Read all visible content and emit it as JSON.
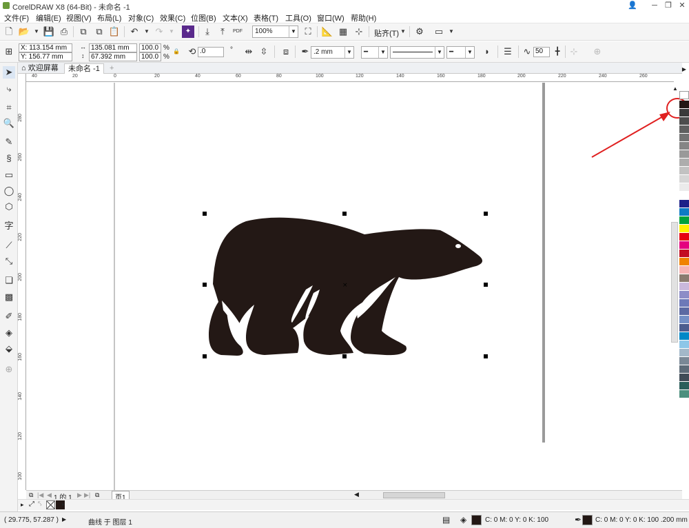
{
  "window": {
    "title": "CorelDRAW X8 (64-Bit) - 未命名 -1"
  },
  "menu": [
    "文件(F)",
    "编辑(E)",
    "视图(V)",
    "布局(L)",
    "对象(C)",
    "效果(C)",
    "位图(B)",
    "文本(X)",
    "表格(T)",
    "工具(O)",
    "窗口(W)",
    "帮助(H)"
  ],
  "toolbar": {
    "zoom": "100%",
    "snap_label": "贴齐(T)"
  },
  "properties": {
    "x": "X: 113.154 mm",
    "y": "Y: 156.77 mm",
    "width": "135.081 mm",
    "height": "67.392 mm",
    "scale_x": "100.0",
    "scale_y": "100.0",
    "percent": "%",
    "rotation": ".0",
    "degree": "°",
    "outline_width": ".2 mm",
    "smoothing": "50"
  },
  "tabs": {
    "welcome": "欢迎屏幕",
    "document": "未命名 -1"
  },
  "ruler_h": [
    "40",
    "20",
    "0",
    "20",
    "40",
    "60",
    "80",
    "100",
    "120",
    "140",
    "160",
    "180",
    "200",
    "220",
    "240",
    "260"
  ],
  "ruler_v": [
    "280",
    "260",
    "240",
    "220",
    "200",
    "180",
    "160",
    "140",
    "120",
    "100"
  ],
  "pagebar": {
    "page_count": "1 的 1",
    "page_tab": "页1"
  },
  "status": {
    "coords": "( 29.775, 57.287 )",
    "selection": "曲线 于 图层 1",
    "fill": "C: 0 M: 0 Y: 0 K: 100",
    "outline": "C: 0 M: 0 Y: 0 K: 100 .200 mm"
  },
  "colors": {
    "fill": "#231815",
    "annotation": "#e02020",
    "palette": [
      "#ffffff",
      "#231815",
      "#3a3a3a",
      "#4d4d4d",
      "#5f5f5f",
      "#727272",
      "#858585",
      "#999999",
      "#adadad",
      "#c2c2c2",
      "#d6d6d6",
      "#ebebeb",
      "#ffffff",
      "#1d2088",
      "#0e7bc4",
      "#00a23b",
      "#fff100",
      "#e60012",
      "#e4007f",
      "#c30d23",
      "#f08300",
      "#f6b4b4",
      "#8a7b6f",
      "#c9b8dc",
      "#8d8cc7",
      "#6d79b8",
      "#5c6aa3",
      "#7490c6",
      "#4c5d8f",
      "#0088c7",
      "#8ec6e8",
      "#a3b8c9",
      "#7a8896",
      "#5d6b78",
      "#404c57",
      "#2a5e5a",
      "#4d8f7e"
    ]
  }
}
